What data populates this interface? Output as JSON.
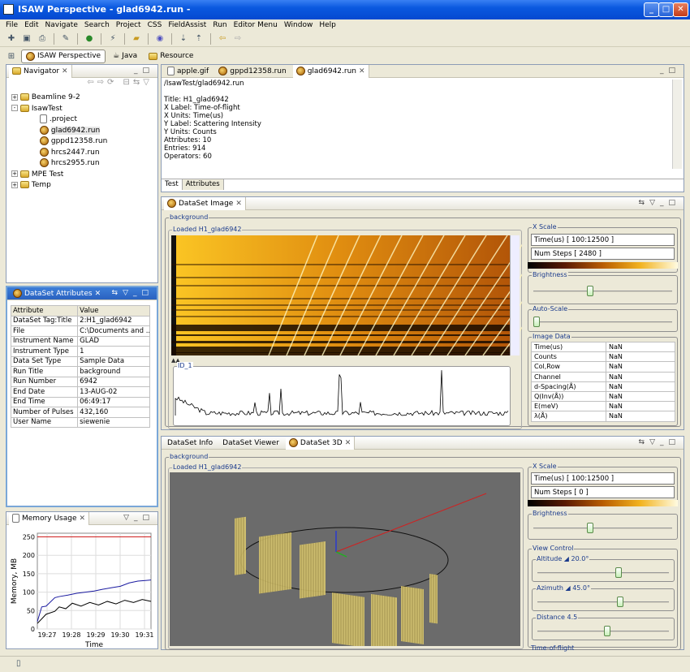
{
  "window": {
    "title": "ISAW Perspective - glad6942.run -"
  },
  "menu": [
    "File",
    "Edit",
    "Navigate",
    "Search",
    "Project",
    "CSS",
    "FieldAssist",
    "Run",
    "Editor Menu",
    "Window",
    "Help"
  ],
  "perspectives": [
    "ISAW Perspective",
    "Java",
    "Resource"
  ],
  "navigator": {
    "title": "Navigator",
    "tree": [
      {
        "label": "Beamline 9-2",
        "type": "folder",
        "indent": 0,
        "toggle": "+"
      },
      {
        "label": "IsawTest",
        "type": "folder",
        "indent": 0,
        "toggle": "-"
      },
      {
        "label": ".project",
        "type": "file",
        "indent": 1
      },
      {
        "label": "glad6942.run",
        "type": "run",
        "indent": 1,
        "selected": true
      },
      {
        "label": "gppd12358.run",
        "type": "run",
        "indent": 1
      },
      {
        "label": "hrcs2447.run",
        "type": "run",
        "indent": 1
      },
      {
        "label": "hrcs2955.run",
        "type": "run",
        "indent": 1
      },
      {
        "label": "MPE Test",
        "type": "folder",
        "indent": 0,
        "toggle": "+"
      },
      {
        "label": "Temp",
        "type": "folder",
        "indent": 0,
        "toggle": "+"
      }
    ]
  },
  "attributes": {
    "title": "DataSet Attributes",
    "col1": "Attribute",
    "col2": "Value",
    "rows": [
      [
        "DataSet Tag:Title",
        "2:H1_glad6942"
      ],
      [
        "File",
        "C:\\Documents and ..."
      ],
      [
        "Instrument Name",
        "GLAD"
      ],
      [
        "Instrument Type",
        "1"
      ],
      [
        "Data Set Type",
        "Sample Data"
      ],
      [
        "Run Title",
        "background"
      ],
      [
        "Run Number",
        "6942"
      ],
      [
        "End Date",
        "13-AUG-02"
      ],
      [
        "End Time",
        "06:49:17"
      ],
      [
        "Number of Pulses",
        "432,160"
      ],
      [
        "User Name",
        "siewenie"
      ]
    ]
  },
  "memory": {
    "title": "Memory Usage"
  },
  "chart_data": {
    "type": "line",
    "title": "",
    "xlabel": "Time",
    "ylabel": "Memory, MB",
    "x_ticks": [
      "19:27",
      "19:28",
      "19:29",
      "19:30",
      "19:31"
    ],
    "y_ticks": [
      0,
      50,
      100,
      150,
      200,
      250
    ],
    "ylim": [
      0,
      260
    ],
    "series": [
      {
        "color": "#d02020",
        "x": [
          0,
          5.2
        ],
        "values": [
          250,
          250
        ]
      },
      {
        "color": "#1a1aa0",
        "x": [
          0,
          0.2,
          0.4,
          0.8,
          1.0,
          1.4,
          1.8,
          2.2,
          2.6,
          3.0,
          3.4,
          3.8,
          4.2,
          4.6,
          5.0,
          5.2
        ],
        "values": [
          20,
          60,
          62,
          85,
          88,
          92,
          97,
          100,
          103,
          108,
          112,
          116,
          125,
          130,
          132,
          133
        ]
      },
      {
        "color": "#000000",
        "x": [
          0,
          0.4,
          0.8,
          1.0,
          1.3,
          1.6,
          2.0,
          2.4,
          2.8,
          3.2,
          3.6,
          4.0,
          4.4,
          4.8,
          5.2
        ],
        "values": [
          15,
          40,
          48,
          60,
          55,
          70,
          62,
          72,
          65,
          75,
          68,
          78,
          72,
          80,
          75
        ]
      }
    ]
  },
  "editor": {
    "tabs": [
      "apple.gif",
      "gppd12358.run",
      "glad6942.run"
    ],
    "path": "/IsawTest/glad6942.run",
    "lines": [
      "Title: H1_glad6942",
      "X Label: Time-of-flight",
      "X Units: Time(us)",
      "Y Label: Scattering Intensity",
      "Y Units: Counts",
      "Attributes: 10",
      "Entries: 914",
      "Operators: 60"
    ],
    "bottom_tabs": [
      "Test",
      "Attributes"
    ]
  },
  "image_view": {
    "title": "DataSet Image",
    "group": "background",
    "loaded": "Loaded H1_glad6942",
    "id_label": "ID_1",
    "xscale": {
      "label": "X Scale",
      "time": "Time(us) [ 100:12500 ]",
      "steps": "Num Steps [ 2480 ]"
    },
    "brightness": "Brightness",
    "autoscale": "Auto-Scale",
    "image_data": "Image Data",
    "image_rows": [
      [
        "Time(us)",
        "NaN"
      ],
      [
        "Counts",
        "NaN"
      ],
      [
        "Col,Row",
        "NaN"
      ],
      [
        "Channel",
        "NaN"
      ],
      [
        "d-Spacing(Å)",
        "NaN"
      ],
      [
        "Q(Inv(Å))",
        "NaN"
      ],
      [
        "E(meV)",
        "NaN"
      ],
      [
        "λ(Å)",
        "NaN"
      ]
    ]
  },
  "view3d": {
    "tabs": [
      "DataSet Info",
      "DataSet Viewer",
      "DataSet 3D"
    ],
    "group": "background",
    "loaded": "Loaded H1_glad6942",
    "xscale": {
      "label": "X Scale",
      "time": "Time(us) [ 100:12500 ]",
      "steps": "Num Steps [ 0 ]"
    },
    "brightness": "Brightness",
    "view_control": "View Control",
    "altitude": "Altitude ◢ 20.0°",
    "azimuth": "Azimuth ◢ 45.0°",
    "distance": "Distance 4.5",
    "tof": "Time-of-flight"
  }
}
